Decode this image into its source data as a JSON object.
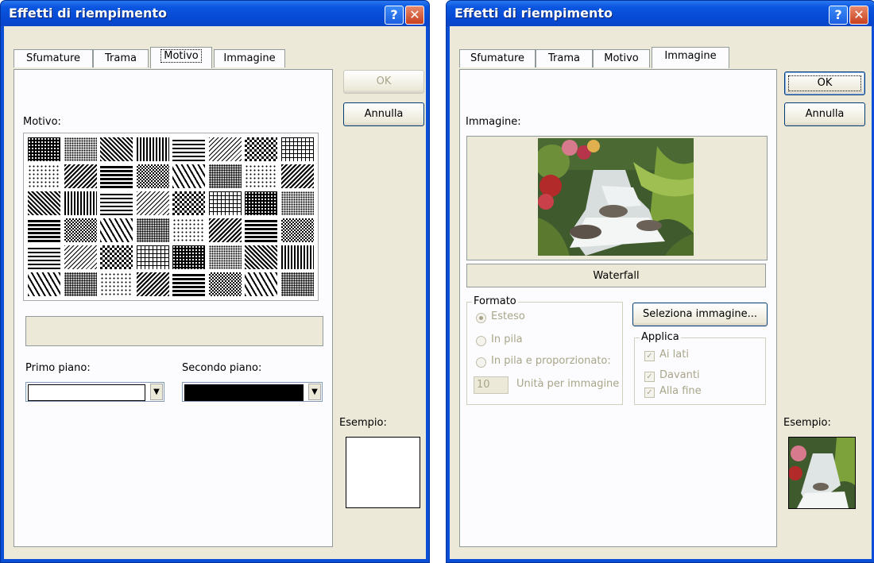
{
  "left_dialog": {
    "title": "Effetti di riempimento",
    "tabs": [
      "Sfumature",
      "Trama",
      "Motivo",
      "Immagine"
    ],
    "active_tab": "Motivo",
    "ok_label": "OK",
    "cancel_label": "Annulla",
    "pattern_label": "Motivo:",
    "foreground_label": "Primo piano:",
    "background_label": "Secondo piano:",
    "foreground_color": "#ffffff",
    "background_color": "#000000",
    "sample_label": "Esempio:"
  },
  "right_dialog": {
    "title": "Effetti di riempimento",
    "tabs": [
      "Sfumature",
      "Trama",
      "Motivo",
      "Immagine"
    ],
    "active_tab": "Immagine",
    "ok_label": "OK",
    "cancel_label": "Annulla",
    "image_label": "Immagine:",
    "image_name": "Waterfall",
    "format_group": "Formato",
    "format_options": [
      "Esteso",
      "In pila",
      "In pila e proporzionato:"
    ],
    "units_value": "10",
    "units_label": "Unità per immagine",
    "select_image_button": "Seleziona immagine...",
    "apply_group": "Applica",
    "apply_options": [
      "Ai lati",
      "Davanti",
      "Alla fine"
    ],
    "sample_label": "Esempio:"
  },
  "colors": {
    "titlebar": "#0a56e0",
    "dialog_bg": "#ece9d8",
    "panel_bg": "#fcfcfe"
  }
}
